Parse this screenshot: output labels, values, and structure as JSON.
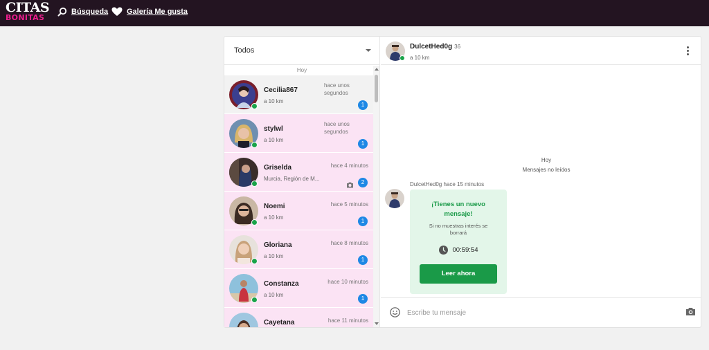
{
  "brand": {
    "line1": "CITAS",
    "line2": "BONITAS"
  },
  "nav": {
    "search_label": "Búsqueda",
    "likes_label": "Galería Me gusta"
  },
  "list": {
    "filter_label": "Todos",
    "day_label": "Hoy",
    "conversations": [
      {
        "name": "Cecilia867",
        "time": "hace unos segundos",
        "distance": "a 10 km",
        "unread": "1"
      },
      {
        "name": "stylwl",
        "time": "hace unos segundos",
        "distance": "a 10 km",
        "unread": "1"
      },
      {
        "name": "Griselda",
        "time": "hace 4 minutos",
        "distance": "Murcia, Región de M...",
        "unread": "2"
      },
      {
        "name": "Noemi",
        "time": "hace 5 minutos",
        "distance": "a 10 km",
        "unread": "1"
      },
      {
        "name": "Gloriana",
        "time": "hace 8 minutos",
        "distance": "a 10 km",
        "unread": "1"
      },
      {
        "name": "Constanza",
        "time": "hace 10 minutos",
        "distance": "a 10 km",
        "unread": "1"
      },
      {
        "name": "Cayetana",
        "time": "hace 11 minutos",
        "distance": "",
        "unread": ""
      }
    ]
  },
  "chat": {
    "name": "DulcetHed0g",
    "age": "36",
    "distance": "a 10 km",
    "day_label": "Hoy",
    "unread_label": "Mensajes no leídos",
    "message_meta": "DulcetHed0g hace 15 minutos",
    "bubble_title": "¡Tienes un nuevo mensaje!",
    "bubble_subtitle": "Si no muestras interés se borrará",
    "timer": "00:59:54",
    "read_button": "Leer ahora",
    "composer_placeholder": "Escribe tu mensaje"
  },
  "colors": {
    "topbar": "#231421",
    "brand_pink": "#ec1f8e",
    "unread_row": "#fbe3f4",
    "online": "#1aa34a",
    "badge": "#1e88e5",
    "cta_green": "#1a9a48",
    "bubble_bg": "#e3f6e9"
  },
  "icons": {
    "search": "search-icon",
    "heart": "heart-icon",
    "caret": "chevron-down-icon",
    "camera": "camera-icon",
    "clock": "clock-icon",
    "emoji": "emoji-icon",
    "menu": "more-vertical-icon"
  }
}
